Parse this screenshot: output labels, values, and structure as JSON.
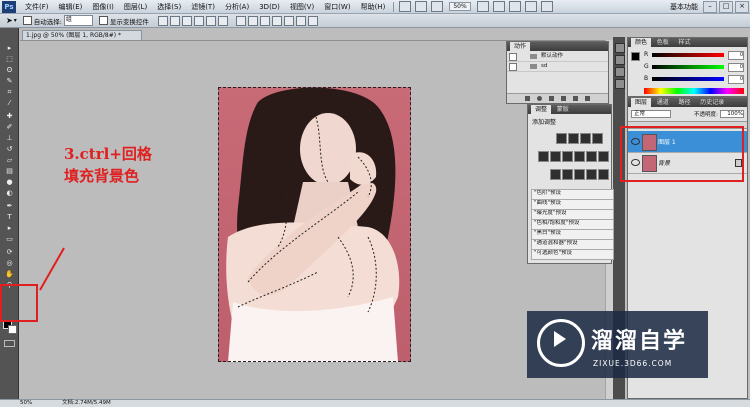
{
  "app": {
    "logo_text": "Ps"
  },
  "menu": {
    "items": [
      "文件(F)",
      "编辑(E)",
      "图像(I)",
      "图层(L)",
      "选择(S)",
      "滤镜(T)",
      "分析(A)",
      "3D(D)",
      "视图(V)",
      "窗口(W)",
      "帮助(H)"
    ],
    "zoom": "50%",
    "workspace": "基本功能",
    "window_buttons": [
      "–",
      "□",
      "×"
    ]
  },
  "options": {
    "auto_select_label": "自动选择:",
    "auto_select_value": "组",
    "show_transform_label": "显示变换控件"
  },
  "document": {
    "tab_title": "1.jpg @ 50% (图层 1, RGB/8#) *",
    "zoom_readout": "50%",
    "doc_info": "文档:2.74M/5.49M"
  },
  "annotation": {
    "line1": "3.ctrl+回格",
    "line2": "填充背景色",
    "color": "#e02020"
  },
  "actions_panel": {
    "tab": "动作",
    "rows": [
      {
        "label": "默认动作"
      },
      {
        "label": "sd"
      }
    ]
  },
  "adjustments_panel": {
    "tabs": [
      "调整",
      "蒙版"
    ],
    "title": "添加调整",
    "presets": [
      "\"色阶\"预设",
      "\"曲线\"预设",
      "\"曝光度\"预设",
      "\"色相/饱和度\"预设",
      "\"黑白\"预设",
      "\"通道混和器\"预设",
      "\"可选颜色\"预设"
    ]
  },
  "color_panel": {
    "tabs": [
      "颜色",
      "色板",
      "样式"
    ],
    "channels": [
      {
        "label": "R",
        "value": "0"
      },
      {
        "label": "G",
        "value": "0"
      },
      {
        "label": "B",
        "value": "0"
      }
    ]
  },
  "layers_panel": {
    "tabs": [
      "图层",
      "通道",
      "路径",
      "历史记录"
    ],
    "blend_mode": "正常",
    "opacity_label": "不透明度:",
    "opacity_value": "100%",
    "layers": [
      {
        "name": "图层 1",
        "selected": true
      },
      {
        "name": "背景",
        "selected": false
      }
    ],
    "highlight_color": "#3a8fd6"
  },
  "watermark": {
    "title": "溜溜自学",
    "url": "ZIXUE.3D66.COM"
  }
}
